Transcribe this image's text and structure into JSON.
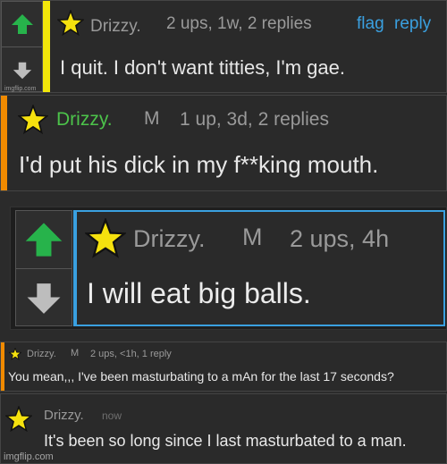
{
  "comments": [
    {
      "author": "Drizzy.",
      "meta": "2 ups, 1w, 2 replies",
      "actions": {
        "flag": "flag",
        "reply": "reply"
      },
      "text": "I quit. I don't want titties, I'm gae.",
      "accent": "#f2e70a",
      "watermark": "imgflip.com"
    },
    {
      "author": "Drizzy.",
      "badge": "M",
      "meta": "1 up, 3d, 2 replies",
      "text": "I'd put his dick in my f**king mouth.",
      "accent": "#f08a00",
      "author_color": "#4cc34a"
    },
    {
      "author": "Drizzy.",
      "badge": "M",
      "meta": "2 ups, 4h",
      "text": "I will eat big balls.",
      "accent": "#3aa0e0"
    },
    {
      "author": "Drizzy.",
      "badge": "M",
      "meta": "2 ups, <1h, 1 reply",
      "text": "You mean,,, I've been masturbating to a mAn for the last 17 seconds?",
      "accent": "#f08a00"
    },
    {
      "author": "Drizzy.",
      "meta": "now",
      "text": "It's been so long since I last masturbated to a man."
    }
  ],
  "icons": {
    "upvote": "up-arrow-icon",
    "downvote": "down-arrow-icon",
    "avatar": "star-icon"
  },
  "colors": {
    "up_arrow": "#27b34b",
    "down_arrow": "#bdbdbd",
    "star_fill": "#f5e10e"
  },
  "footer_watermark": "imgflip.com"
}
